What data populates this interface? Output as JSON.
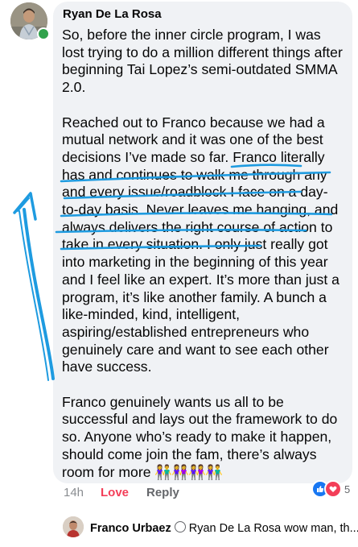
{
  "comment": {
    "author": "Ryan De La Rosa",
    "paragraphs": [
      "So, before the inner circle program, I was lost trying to do a million different things after beginning Tai Lopez’s semi-outdated SMMA 2.0.",
      "Reached out to Franco because we had a mutual network and it was one of the best decisions I’ve made so far. Franco literally has and continues to walk me through any and every issue/roadblock I face on a day-to-day basis. Never leaves me hanging, and always delivers the right course of action to take in every situation. I only just really got into marketing in the beginning of this year and I feel like an expert. It’s more than just a program, it’s like another family. A bunch a like-minded, kind, intelligent, aspiring/established entrepreneurs who genuinely care and want to see each other have success.",
      "Franco genuinely wants us all to be successful and lays out the framework to do so. Anyone who’s ready to make it happen, should come join the fam, there’s always room for more"
    ],
    "emoji": "👫👭👭👫",
    "online_status_color": "#31a24c"
  },
  "actions": {
    "time": "14h",
    "love_label": "Love",
    "reply_label": "Reply",
    "love_color": "#f33e58"
  },
  "reactions": {
    "icons": [
      "like-icon",
      "love-icon"
    ],
    "count": "5"
  },
  "reply_preview": {
    "author": "Franco Urbaez",
    "text": "Ryan De La Rosa wow man, th..."
  },
  "annotation": {
    "ink_color": "#1e9be0"
  }
}
